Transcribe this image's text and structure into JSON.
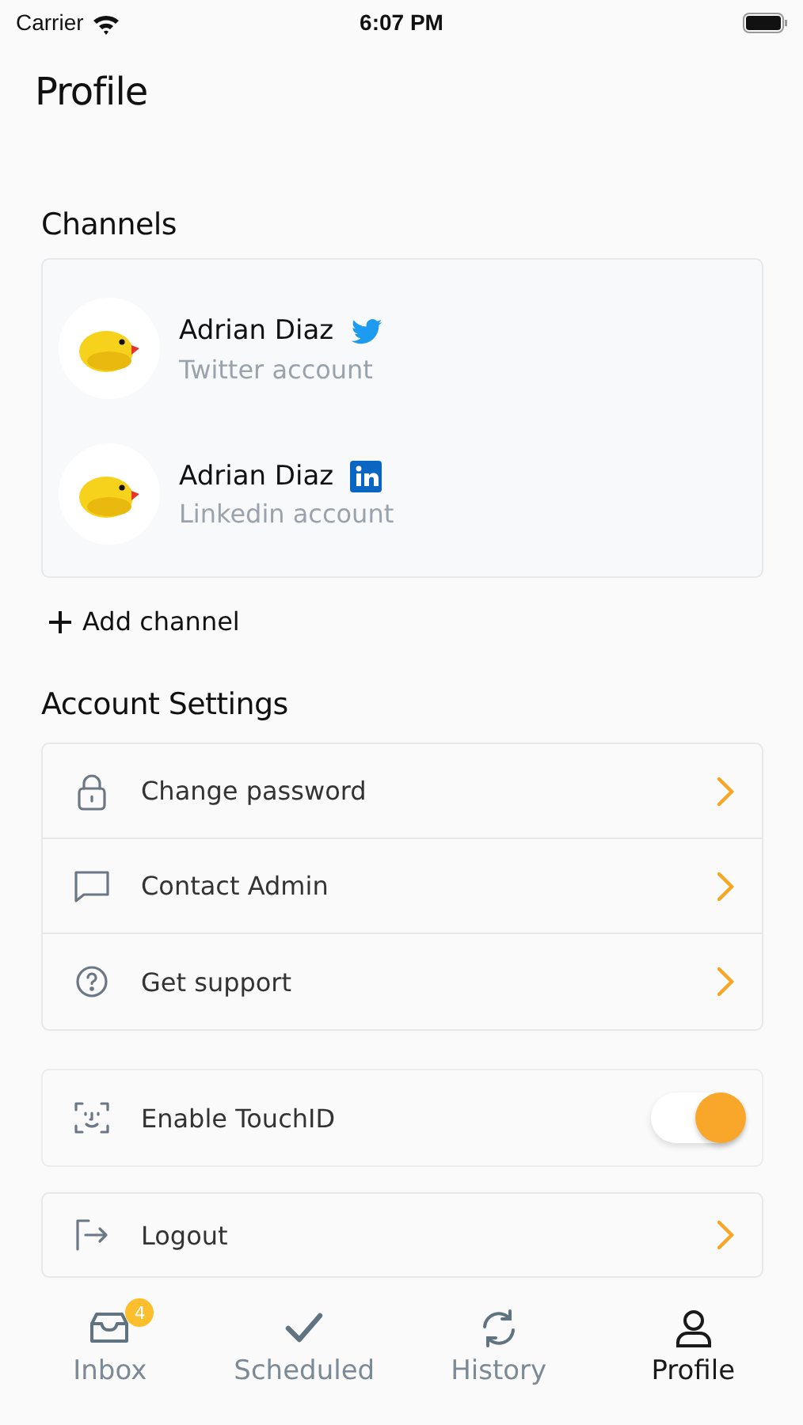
{
  "status_bar": {
    "carrier": "Carrier",
    "time": "6:07 PM"
  },
  "title": "Profile",
  "channels": {
    "heading": "Channels",
    "items": [
      {
        "name": "Adrian Diaz",
        "kind": "twitter",
        "subtitle": "Twitter account"
      },
      {
        "name": "Adrian Diaz",
        "kind": "linkedin",
        "subtitle": "Linkedin account"
      }
    ],
    "add_label": "Add channel"
  },
  "account_settings": {
    "heading": "Account Settings",
    "items": [
      {
        "kind": "lock",
        "label": "Change password"
      },
      {
        "kind": "chat",
        "label": "Contact Admin"
      },
      {
        "kind": "help",
        "label": "Get support"
      }
    ]
  },
  "touch_id": {
    "label": "Enable TouchID",
    "on": true
  },
  "logout": {
    "label": "Logout"
  },
  "tabs": [
    {
      "kind": "inbox",
      "label": "Inbox",
      "selected": false,
      "badge": "4"
    },
    {
      "kind": "check",
      "label": "Scheduled",
      "selected": false
    },
    {
      "kind": "sync",
      "label": "History",
      "selected": false
    },
    {
      "kind": "person",
      "label": "Profile",
      "selected": true
    }
  ]
}
